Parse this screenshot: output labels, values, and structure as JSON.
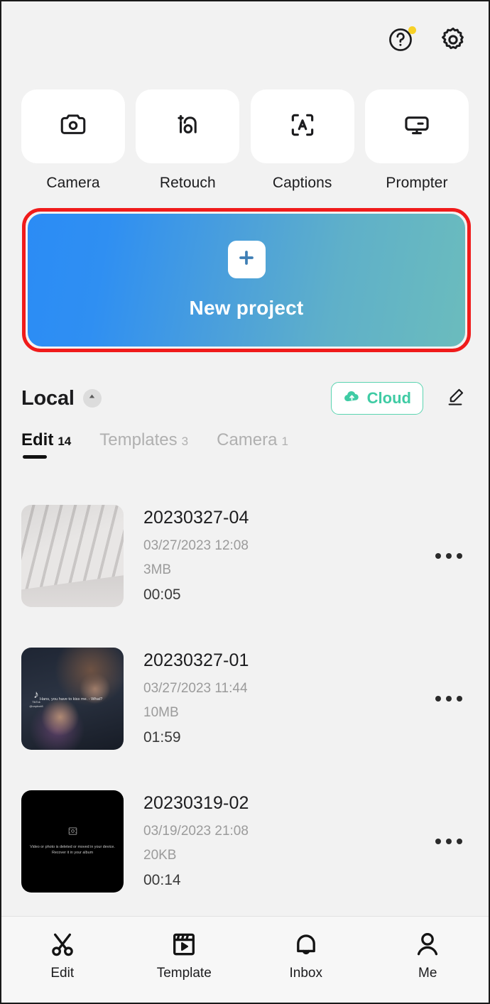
{
  "top_bar": {
    "help_icon": "question-circle-icon",
    "help_badge": "new-dot",
    "settings_icon": "gear-icon"
  },
  "quick_actions": [
    {
      "label": "Camera",
      "icon": "camera-icon"
    },
    {
      "label": "Retouch",
      "icon": "retouch-face-icon"
    },
    {
      "label": "Captions",
      "icon": "auto-captions-icon"
    },
    {
      "label": "Prompter",
      "icon": "teleprompter-icon"
    }
  ],
  "new_project": {
    "label": "New project",
    "plus_icon": "plus-icon",
    "gradient_start": "#2b8cf5",
    "gradient_end": "#6bbcbd",
    "highlight_color": "#f01b1b"
  },
  "local_section": {
    "title": "Local",
    "collapse_icon": "chevron-up-icon",
    "cloud_label": "Cloud",
    "cloud_icon": "cloud-upload-icon",
    "cloud_color": "#3fcba4",
    "edit_icon": "pencil-icon"
  },
  "tabs": [
    {
      "label": "Edit",
      "count": "14",
      "active": true
    },
    {
      "label": "Templates",
      "count": "3",
      "active": false
    },
    {
      "label": "Camera",
      "count": "1",
      "active": false
    }
  ],
  "projects": [
    {
      "title": "20230327-04",
      "date": "03/27/2023 12:08",
      "size": "3MB",
      "duration": "00:05",
      "thumb_type": "keyboard",
      "more_icon": "more-horizontal-icon"
    },
    {
      "title": "20230327-01",
      "date": "03/27/2023 11:44",
      "size": "10MB",
      "duration": "01:59",
      "thumb_type": "video",
      "thumb_watermark": "TikTok",
      "thumb_watermark_handle": "@captcut8",
      "thumb_caption": "Hans, you have to kiss me. - What?",
      "more_icon": "more-horizontal-icon"
    },
    {
      "title": "20230319-02",
      "date": "03/19/2023 21:08",
      "size": "20KB",
      "duration": "00:14",
      "thumb_type": "missing",
      "thumb_message_line1": "Video or photo is deleted or moved in your device.",
      "thumb_message_line2": "Recover it in your album",
      "more_icon": "more-horizontal-icon"
    }
  ],
  "bottom_nav": [
    {
      "label": "Edit",
      "icon": "scissors-icon",
      "active": true
    },
    {
      "label": "Template",
      "icon": "template-clapper-icon",
      "active": false
    },
    {
      "label": "Inbox",
      "icon": "bell-icon",
      "active": false
    },
    {
      "label": "Me",
      "icon": "person-icon",
      "active": false
    }
  ]
}
